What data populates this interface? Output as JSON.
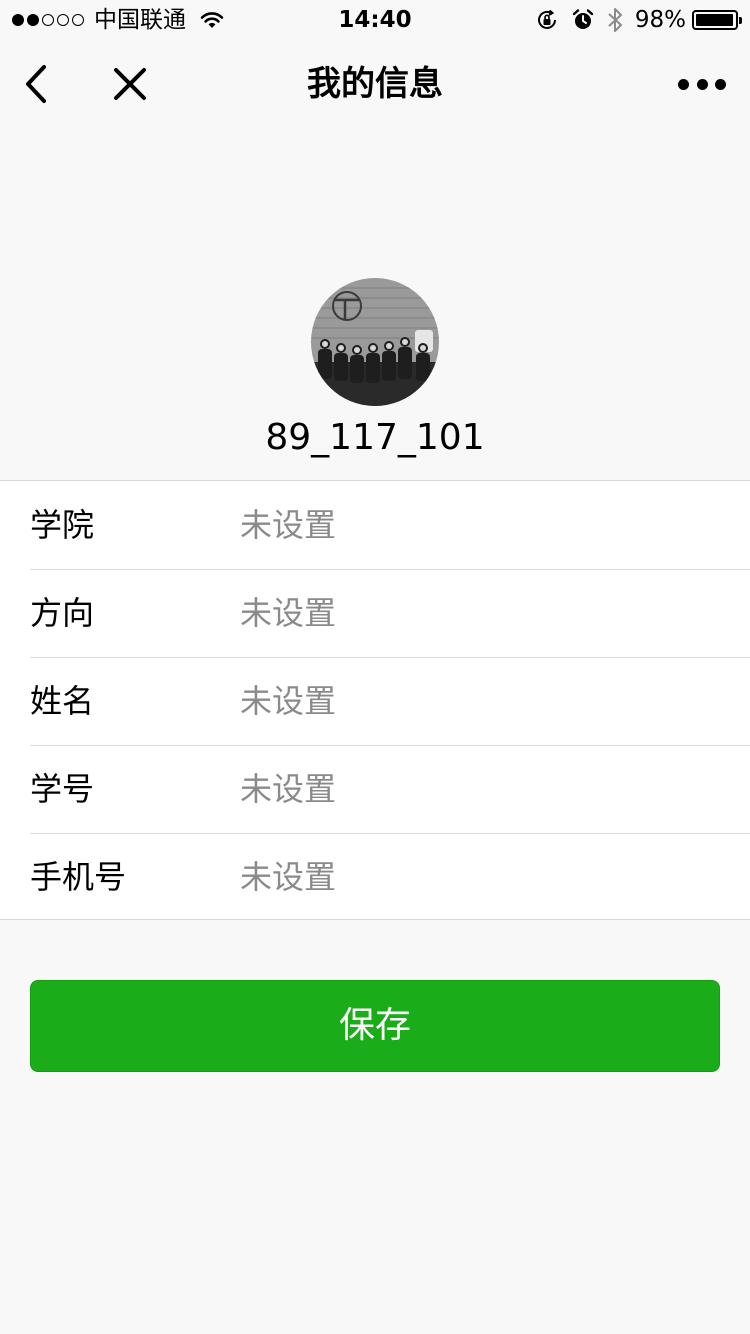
{
  "status_bar": {
    "carrier": "中国联通",
    "time": "14:40",
    "battery_percent": "98%",
    "battery_level": 0.98,
    "signal_bars_filled": 2,
    "signal_bars_total": 5
  },
  "nav": {
    "title": "我的信息"
  },
  "profile": {
    "username": "89_117_101"
  },
  "form": {
    "rows": [
      {
        "label": "学院",
        "value": "未设置"
      },
      {
        "label": "方向",
        "value": "未设置"
      },
      {
        "label": "姓名",
        "value": "未设置"
      },
      {
        "label": "学号",
        "value": "未设置"
      },
      {
        "label": "手机号",
        "value": "未设置"
      }
    ]
  },
  "actions": {
    "save_label": "保存"
  },
  "colors": {
    "background": "#f8f8f8",
    "primary_green": "#1aad19",
    "placeholder_gray": "#8a8a8a",
    "divider": "#d9d9d9"
  },
  "icons": {
    "back": "chevron-left-icon",
    "close": "close-icon",
    "more": "more-dots-icon",
    "wifi": "wifi-icon",
    "rotation_lock": "rotation-lock-icon",
    "alarm": "alarm-icon",
    "bluetooth": "bluetooth-icon",
    "battery": "battery-icon"
  }
}
